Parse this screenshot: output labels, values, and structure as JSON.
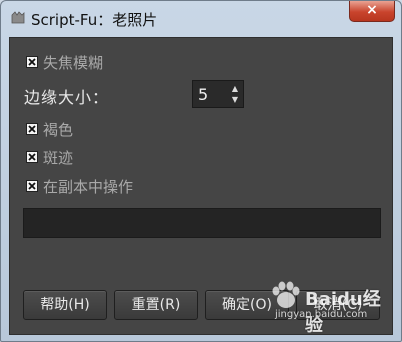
{
  "window": {
    "title": "Script-Fu：老照片",
    "close_label": "×"
  },
  "options": {
    "defocus": {
      "label": "失焦模糊",
      "checked": true
    },
    "size_label": "边缘大小：",
    "size_value": "5",
    "sepia": {
      "label": "褐色",
      "checked": true
    },
    "mottle": {
      "label": "斑迹",
      "checked": true
    },
    "work_on_copy": {
      "label": "在副本中操作",
      "checked": true
    }
  },
  "progress": {
    "fraction": 0
  },
  "buttons": {
    "help": "帮助(H)",
    "reset": "重置(R)",
    "ok": "确定(O)",
    "cancel": "取消(C)"
  },
  "watermark": {
    "brand": "Baidu经验",
    "url": "jingyan.baidu.com"
  }
}
